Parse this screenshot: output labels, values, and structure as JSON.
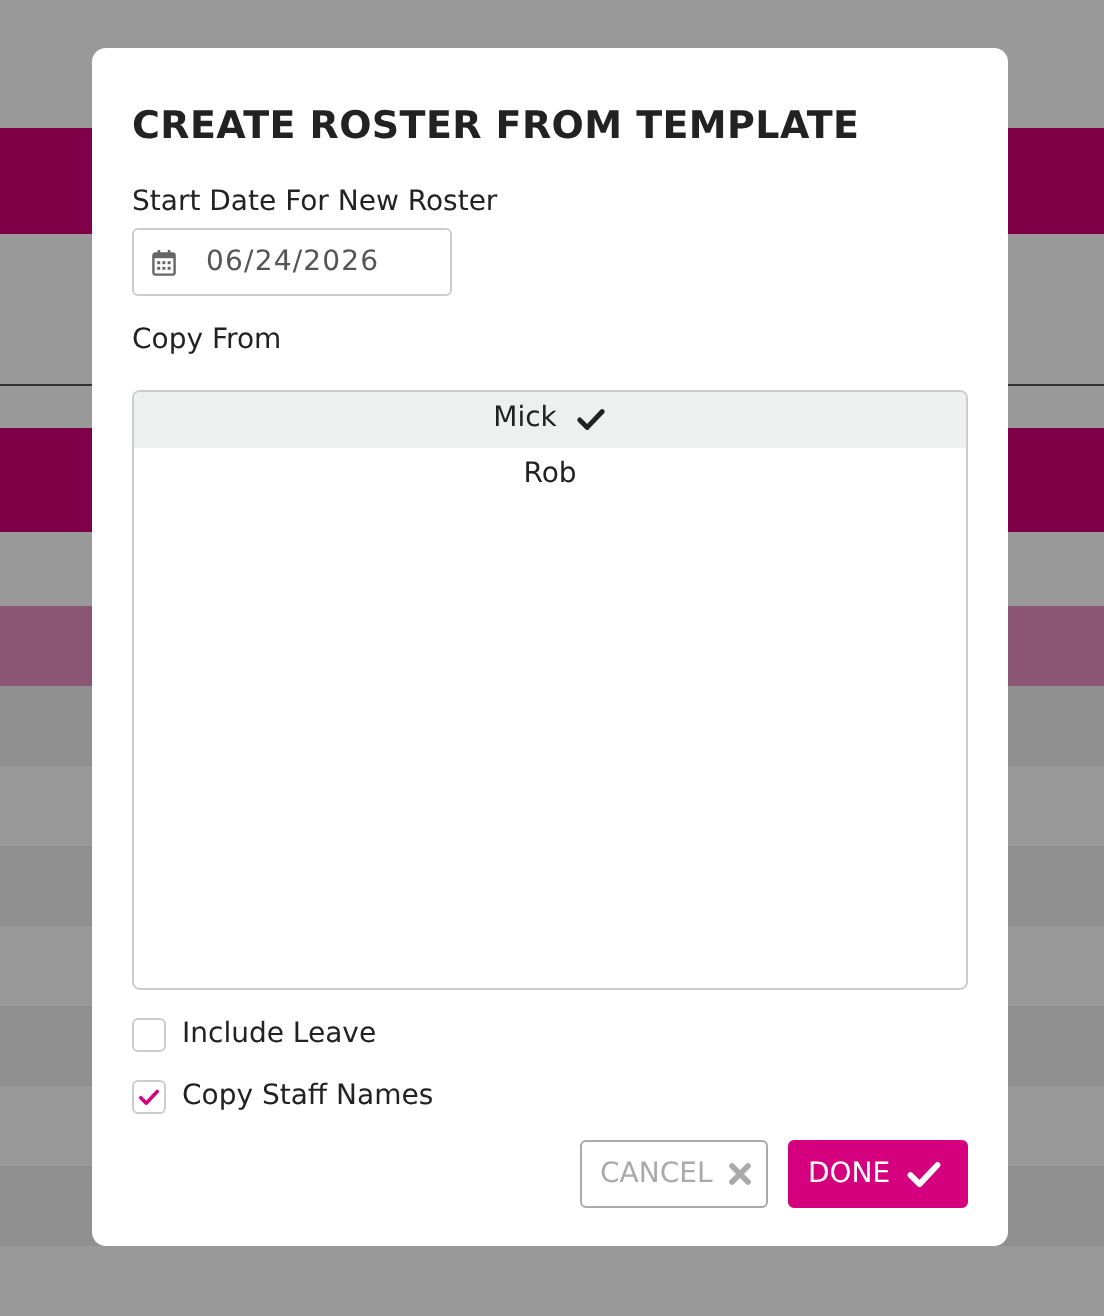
{
  "dialog": {
    "title": "CREATE ROSTER FROM TEMPLATE",
    "start_date": {
      "label": "Start Date For New Roster",
      "value": "06/24/2026"
    },
    "copy_from": {
      "label": "Copy From",
      "items": [
        {
          "name": "Mick",
          "selected": true
        },
        {
          "name": "Rob",
          "selected": false
        }
      ]
    },
    "options": [
      {
        "label": "Include Leave",
        "checked": false
      },
      {
        "label": "Copy Staff Names",
        "checked": true
      }
    ],
    "buttons": [
      {
        "label": "CANCEL",
        "kind": "cancel"
      },
      {
        "label": "DONE",
        "kind": "done"
      }
    ]
  }
}
